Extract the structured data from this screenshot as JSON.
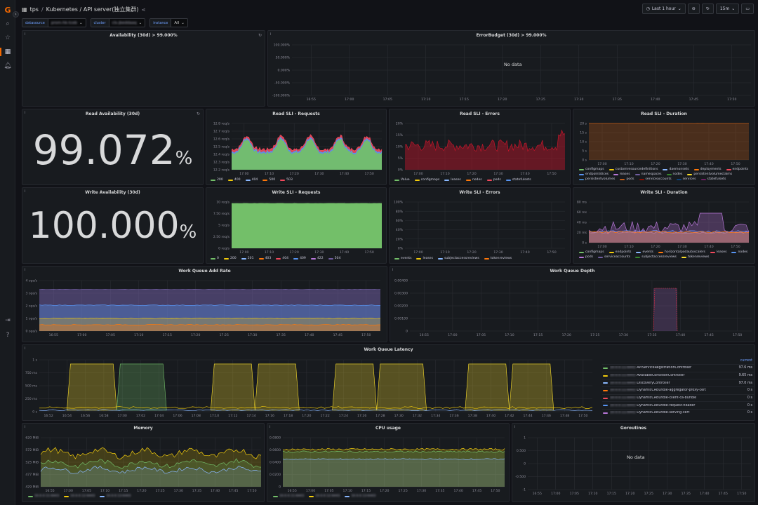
{
  "nav": {
    "logo": "G",
    "icons": [
      "search-icon",
      "star-icon",
      "dashboards-icon",
      "alert-bell-icon",
      "sign-in-icon",
      "help-icon"
    ]
  },
  "header": {
    "folder": "tps",
    "separator": "/",
    "title": "Kubernetes / API server(独立集群)",
    "time_range": "Last 1 hour",
    "refresh_interval": "15m"
  },
  "variables": [
    {
      "label": "datasource",
      "value": "prom-hk-tceb"
    },
    {
      "label": "cluster",
      "value": "cls-jbeddaaq"
    },
    {
      "label": "instance",
      "value": "All"
    }
  ],
  "panels": {
    "availability": {
      "title": "Availability (30d) > 99.000%"
    },
    "error_budget": {
      "title": "ErrorBudget (30d) > 99.000%",
      "no_data": "No data",
      "yticks": [
        "100.000%",
        "50.000%",
        "0.000%",
        "-50.000%",
        "-100.000%"
      ]
    },
    "read_availability": {
      "title": "Read Availability (30d)",
      "value": "99.072",
      "unit": "%"
    },
    "write_availability": {
      "title": "Write Availability (30d)",
      "value": "100.000",
      "unit": "%"
    },
    "read_sli_requests": {
      "title": "Read SLI - Requests",
      "yticks": [
        "12.8 req/s",
        "12.7 req/s",
        "12.6 req/s",
        "12.5 req/s",
        "12.4 req/s",
        "12.3 req/s",
        "12.2 req/s"
      ],
      "legend": [
        {
          "name": "200",
          "color": "#73bf69"
        },
        {
          "name": "400",
          "color": "#f2cc0c"
        },
        {
          "name": "404",
          "color": "#8ab8ff"
        },
        {
          "name": "500",
          "color": "#ff780a"
        },
        {
          "name": "503",
          "color": "#f2495c"
        }
      ]
    },
    "read_sli_errors": {
      "title": "Read SLI - Errors",
      "yticks": [
        "20%",
        "15%",
        "10%",
        "5%",
        "0%"
      ],
      "legend": [
        {
          "name": "Value",
          "color": "#73bf69"
        },
        {
          "name": "configmaps",
          "color": "#f2cc0c"
        },
        {
          "name": "leases",
          "color": "#8ab8ff"
        },
        {
          "name": "nodes",
          "color": "#ff780a"
        },
        {
          "name": "pods",
          "color": "#f2495c"
        },
        {
          "name": "statefulsets",
          "color": "#5794f2"
        }
      ]
    },
    "read_sli_duration": {
      "title": "Read SLI - Duration",
      "yticks": [
        "20 s",
        "15 s",
        "10 s",
        "5 s",
        "0 s"
      ],
      "legend": [
        {
          "name": "configmaps",
          "color": "#73bf69"
        },
        {
          "name": "customresourcedefinitions",
          "color": "#f2cc0c"
        },
        {
          "name": "daemonsets",
          "color": "#8ab8ff"
        },
        {
          "name": "deployments",
          "color": "#ff780a"
        },
        {
          "name": "endpoints",
          "color": "#f2495c"
        },
        {
          "name": "endpointslices",
          "color": "#5794f2"
        },
        {
          "name": "leases",
          "color": "#b877d9"
        },
        {
          "name": "namespaces",
          "color": "#705da0"
        },
        {
          "name": "nodes",
          "color": "#37872d"
        },
        {
          "name": "persistentvolumeclaims",
          "color": "#fade2a"
        },
        {
          "name": "persistentvolumes",
          "color": "#447ebc"
        },
        {
          "name": "pods",
          "color": "#c15c17"
        },
        {
          "name": "serviceaccounts",
          "color": "#890f02"
        },
        {
          "name": "services",
          "color": "#0a437c"
        },
        {
          "name": "statefulsets",
          "color": "#6d1f62"
        }
      ]
    },
    "write_sli_requests": {
      "title": "Write SLI - Requests",
      "yticks": [
        "10 req/s",
        "7.50 req/s",
        "5 req/s",
        "2.50 req/s",
        "0 req/s"
      ],
      "legend": [
        {
          "name": "0",
          "color": "#73bf69"
        },
        {
          "name": "200",
          "color": "#f2cc0c"
        },
        {
          "name": "201",
          "color": "#8ab8ff"
        },
        {
          "name": "403",
          "color": "#ff780a"
        },
        {
          "name": "404",
          "color": "#f2495c"
        },
        {
          "name": "409",
          "color": "#5794f2"
        },
        {
          "name": "422",
          "color": "#b877d9"
        },
        {
          "name": "504",
          "color": "#705da0"
        }
      ]
    },
    "write_sli_errors": {
      "title": "Write SLI - Errors",
      "yticks": [
        "100%",
        "80%",
        "60%",
        "40%",
        "20%",
        "0%"
      ],
      "legend": [
        {
          "name": "events",
          "color": "#73bf69"
        },
        {
          "name": "leases",
          "color": "#f2cc0c"
        },
        {
          "name": "subjectaccessreviews",
          "color": "#8ab8ff"
        },
        {
          "name": "tokenreviews",
          "color": "#ff780a"
        }
      ]
    },
    "write_sli_duration": {
      "title": "Write SLI - Duration",
      "yticks": [
        "80 ms",
        "60 ms",
        "40 ms",
        "20 ms",
        "0 s"
      ],
      "legend": [
        {
          "name": "configmaps",
          "color": "#73bf69"
        },
        {
          "name": "endpoints",
          "color": "#f2cc0c"
        },
        {
          "name": "events",
          "color": "#8ab8ff"
        },
        {
          "name": "horizontalpodautoscalers",
          "color": "#ff780a"
        },
        {
          "name": "leases",
          "color": "#f2495c"
        },
        {
          "name": "nodes",
          "color": "#5794f2"
        },
        {
          "name": "pods",
          "color": "#b877d9"
        },
        {
          "name": "serviceaccounts",
          "color": "#705da0"
        },
        {
          "name": "subjectaccessreviews",
          "color": "#37872d"
        },
        {
          "name": "tokenreviews",
          "color": "#fade2a"
        }
      ]
    },
    "work_queue_add_rate": {
      "title": "Work Queue Add Rate",
      "yticks": [
        "4 ops/s",
        "3 ops/s",
        "2 ops/s",
        "1 ops/s",
        "0 ops/s"
      ],
      "xticks": [
        "16:55",
        "17:00",
        "17:05",
        "17:10",
        "17:15",
        "17:20",
        "17:25",
        "17:30",
        "17:35",
        "17:40",
        "17:45",
        "17:50"
      ]
    },
    "work_queue_depth": {
      "title": "Work Queue Depth",
      "yticks": [
        "0.00400",
        "0.00300",
        "0.00200",
        "0.00100",
        "0"
      ],
      "xticks": [
        "16:55",
        "17:00",
        "17:05",
        "17:10",
        "17:15",
        "17:20",
        "17:25",
        "17:30",
        "17:35",
        "17:40",
        "17:45",
        "17:50"
      ]
    },
    "work_queue_latency": {
      "title": "Work Queue Latency",
      "yticks": [
        "1 s",
        "750 ms",
        "500 ms",
        "250 ms",
        "0 s"
      ],
      "xticks": [
        "16:52",
        "16:54",
        "16:56",
        "16:58",
        "17:00",
        "17:02",
        "17:04",
        "17:06",
        "17:08",
        "17:10",
        "17:12",
        "17:14",
        "17:16",
        "17:18",
        "17:20",
        "17:22",
        "17:24",
        "17:26",
        "17:28",
        "17:30",
        "17:32",
        "17:34",
        "17:36",
        "17:38",
        "17:40",
        "17:42",
        "17:44",
        "17:46",
        "17:48",
        "17:50"
      ],
      "legend_header": "current",
      "legend": [
        {
          "host": "10.0.0.11:6443",
          "name": "APIServiceRegistrationController",
          "value": "97.6 ms",
          "color": "#73bf69"
        },
        {
          "host": "10.0.0.11:6443",
          "name": "AvailableConditionController",
          "value": "9.65 ms",
          "color": "#f2cc0c"
        },
        {
          "host": "10.0.0.11:6443",
          "name": "DiscoveryController",
          "value": "97.0 ms",
          "color": "#8ab8ff"
        },
        {
          "host": "10.0.0.11:6443",
          "name": "DynamicCABundle-aggregator-proxy-cert",
          "value": "0 s",
          "color": "#ff780a"
        },
        {
          "host": "10.0.0.11:6443",
          "name": "DynamicCABundle-client-ca-bundle",
          "value": "0 s",
          "color": "#f2495c"
        },
        {
          "host": "10.0.0.11:6443",
          "name": "DynamicCABundle-request-header",
          "value": "0 s",
          "color": "#5794f2"
        },
        {
          "host": "10.0.0.11:6443",
          "name": "DynamicCABundle-serving-cert",
          "value": "0 s",
          "color": "#b877d9"
        }
      ]
    },
    "memory": {
      "title": "Memory",
      "yticks": [
        "620 MiB",
        "572 MiB",
        "525 MiB",
        "477 MiB",
        "429 MiB"
      ],
      "xticks": [
        "16:55",
        "17:00",
        "17:05",
        "17:10",
        "17:15",
        "17:20",
        "17:25",
        "17:30",
        "17:35",
        "17:40",
        "17:45",
        "17:50"
      ],
      "legend": [
        {
          "name": "10.0.0.11:6443",
          "color": "#73bf69"
        },
        {
          "name": "10.0.0.12:6443",
          "color": "#f2cc0c"
        },
        {
          "name": "10.0.0.13:6443",
          "color": "#8ab8ff"
        }
      ]
    },
    "cpu_usage": {
      "title": "CPU usage",
      "yticks": [
        "0.0800",
        "0.0600",
        "0.0400",
        "0.0200",
        "0"
      ],
      "xticks": [
        "16:55",
        "17:00",
        "17:05",
        "17:10",
        "17:15",
        "17:20",
        "17:25",
        "17:30",
        "17:35",
        "17:40",
        "17:45",
        "17:50"
      ],
      "legend": [
        {
          "name": "10.0.0.11:6443",
          "color": "#73bf69"
        },
        {
          "name": "10.0.0.12:6443",
          "color": "#f2cc0c"
        },
        {
          "name": "10.0.0.13:6443",
          "color": "#8ab8ff"
        }
      ]
    },
    "goroutines": {
      "title": "Goroutines",
      "no_data": "No data",
      "yticks": [
        "1",
        "0.500",
        "0",
        "-0.500",
        "-1"
      ],
      "xticks": [
        "16:55",
        "17:00",
        "17:05",
        "17:10",
        "17:15",
        "17:20",
        "17:25",
        "17:30",
        "17:35",
        "17:40",
        "17:45",
        "17:50"
      ]
    }
  },
  "xticks_short": [
    "17:00",
    "17:10",
    "17:20",
    "17:30",
    "17:40",
    "17:50"
  ],
  "xticks_error_budget": [
    "16:55",
    "17:00",
    "17:05",
    "17:10",
    "17:15",
    "17:20",
    "17:25",
    "17:30",
    "17:35",
    "17:40",
    "17:45",
    "17:50"
  ]
}
